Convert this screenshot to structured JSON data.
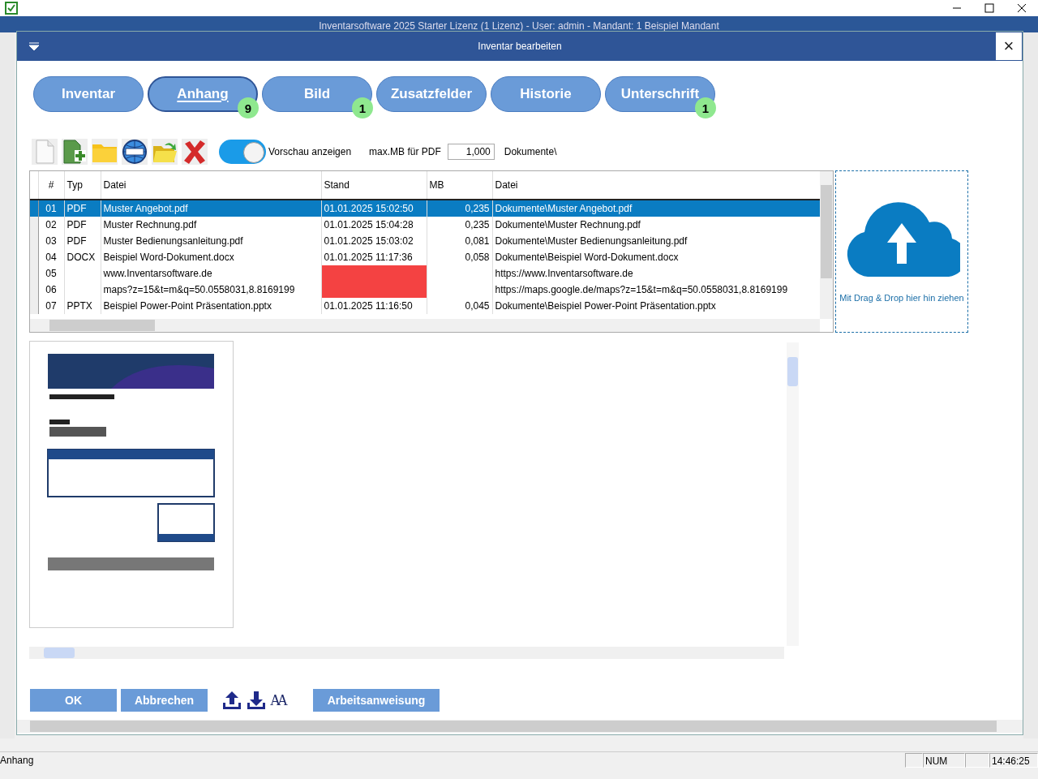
{
  "app": {
    "title": "Inventarsoftware 2025 Starter Lizenz (1 Lizenz) - User: admin - Mandant: 1 Beispiel Mandant"
  },
  "dialog": {
    "title": "Inventar bearbeiten",
    "close": "×"
  },
  "tabs": [
    {
      "label": "Inventar",
      "selected": false
    },
    {
      "label": "Anhang",
      "selected": true,
      "badge": "9"
    },
    {
      "label": "Bild",
      "selected": false,
      "badge": "1"
    },
    {
      "label": "Zusatzfelder",
      "selected": false
    },
    {
      "label": "Historie",
      "selected": false
    },
    {
      "label": "Unterschrift",
      "selected": false,
      "badge": "1"
    }
  ],
  "toolbar": {
    "preview_toggle": {
      "label": "Vorschau anzeigen",
      "on": true
    },
    "max_mb_label": "max.MB für PDF",
    "max_mb_value": "1,000",
    "folder": "Dokumente\\"
  },
  "table": {
    "columns": [
      "#",
      "Typ",
      "Datei",
      "Stand",
      "MB",
      "Datei"
    ],
    "rows": [
      {
        "cells": [
          "01",
          "PDF",
          "Muster Angebot.pdf",
          "01.01.2025 15:02:50",
          "0,235",
          "Dokumente\\Muster Angebot.pdf"
        ],
        "selected": true,
        "missing": false
      },
      {
        "cells": [
          "02",
          "PDF",
          "Muster Rechnung.pdf",
          "01.01.2025 15:04:28",
          "0,235",
          "Dokumente\\Muster Rechnung.pdf"
        ],
        "selected": false,
        "missing": false
      },
      {
        "cells": [
          "03",
          "PDF",
          "Muster Bedienungsanleitung.pdf",
          "01.01.2025 15:03:02",
          "0,081",
          "Dokumente\\Muster Bedienungsanleitung.pdf"
        ],
        "selected": false,
        "missing": false
      },
      {
        "cells": [
          "04",
          "DOCX",
          "Beispiel Word-Dokument.docx",
          "01.01.2025 11:17:36",
          "0,058",
          "Dokumente\\Beispiel Word-Dokument.docx"
        ],
        "selected": false,
        "missing": false
      },
      {
        "cells": [
          "05",
          "",
          "www.Inventarsoftware.de",
          "",
          "",
          "https://www.Inventarsoftware.de"
        ],
        "selected": false,
        "missing": true
      },
      {
        "cells": [
          "06",
          "",
          "maps?z=15&t=m&q=50.0558031,8.8169199",
          "",
          "",
          "https://maps.google.de/maps?z=15&t=m&q=50.0558031,8.8169199"
        ],
        "selected": false,
        "missing": true
      },
      {
        "cells": [
          "07",
          "PPTX",
          "Beispiel Power-Point Präsentation.pptx",
          "01.01.2025 11:16:50",
          "0,045",
          "Dokumente\\Beispiel Power-Point Präsentation.pptx"
        ],
        "selected": false,
        "missing": false
      }
    ]
  },
  "dropzone": {
    "label": "Mit Drag & Drop hier hin ziehen"
  },
  "buttons": {
    "ok": "OK",
    "cancel": "Abbrechen",
    "font_glyph": "AA",
    "instruction": "Arbeitsanweisung"
  },
  "status_bar": {
    "message": "Anhang",
    "panels": [
      {
        "kind": "blank"
      },
      {
        "kind": "text",
        "text": "NUM"
      },
      {
        "kind": "blank"
      },
      {
        "kind": "text",
        "text": "14:46:25"
      }
    ]
  }
}
